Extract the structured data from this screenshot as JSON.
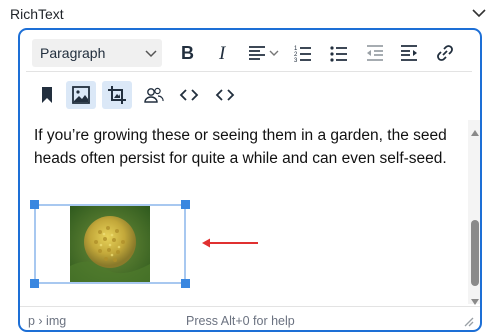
{
  "field": {
    "label": "RichText",
    "toggle_icon": "chevron-down-icon"
  },
  "toolbar": {
    "format_select": {
      "value": "Paragraph",
      "icon": "chevron-down-icon"
    },
    "row1": [
      {
        "name": "bold-button",
        "icon": "bold-icon"
      },
      {
        "name": "italic-button",
        "icon": "italic-icon"
      },
      {
        "name": "align-button",
        "icon": "align-left-icon"
      },
      {
        "name": "numbered-list-button",
        "icon": "numbered-list-icon"
      },
      {
        "name": "bullet-list-button",
        "icon": "bullet-list-icon"
      },
      {
        "name": "outdent-button",
        "icon": "outdent-icon",
        "disabled": true
      },
      {
        "name": "indent-button",
        "icon": "indent-icon"
      },
      {
        "name": "link-button",
        "icon": "link-icon"
      }
    ],
    "row2": [
      {
        "name": "bookmark-button",
        "icon": "bookmark-icon"
      },
      {
        "name": "image-button",
        "icon": "image-icon",
        "active": true
      },
      {
        "name": "crop-button",
        "icon": "crop-icon",
        "active": true
      },
      {
        "name": "users-button",
        "icon": "users-icon"
      },
      {
        "name": "code-button",
        "icon": "code-icon"
      },
      {
        "name": "source-code-button",
        "icon": "code-icon"
      }
    ]
  },
  "content": {
    "paragraph": "If you’re growing these or seeing them in a garden, the seed heads often persist for quite a while and can even self-seed.",
    "image": {
      "icon": "flower-seed-head-image",
      "selected": true
    }
  },
  "statusbar": {
    "path": "p › img",
    "help": "Press Alt+0 for help"
  },
  "colors": {
    "accent": "#1d6fd6",
    "selection_handle": "#3a87e0",
    "annotation_arrow": "#e03030",
    "active_button_bg": "#dbe8f7"
  }
}
